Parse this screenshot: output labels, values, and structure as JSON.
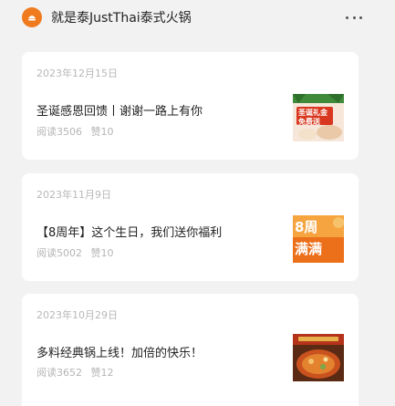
{
  "header": {
    "title": "就是泰JustThai泰式火锅"
  },
  "articles": [
    {
      "date": "2023年12月15日",
      "title": "圣诞感恩回馈丨谢谢一路上有你",
      "reads": "阅读3506",
      "likes": "赞10",
      "thumb_text_1": "圣诞礼金",
      "thumb_text_2": "免费送"
    },
    {
      "date": "2023年11月9日",
      "title": "【8周年】这个生日，我们送你福利",
      "reads": "阅读5002",
      "likes": "赞10",
      "thumb_text_1": "8周",
      "thumb_text_2": "满满"
    },
    {
      "date": "2023年10月29日",
      "title": "多料经典锅上线！加倍的快乐！",
      "reads": "阅读3652",
      "likes": "赞12"
    }
  ],
  "colors": {
    "brand": "#f07a1e",
    "background": "#f2f2f2"
  }
}
